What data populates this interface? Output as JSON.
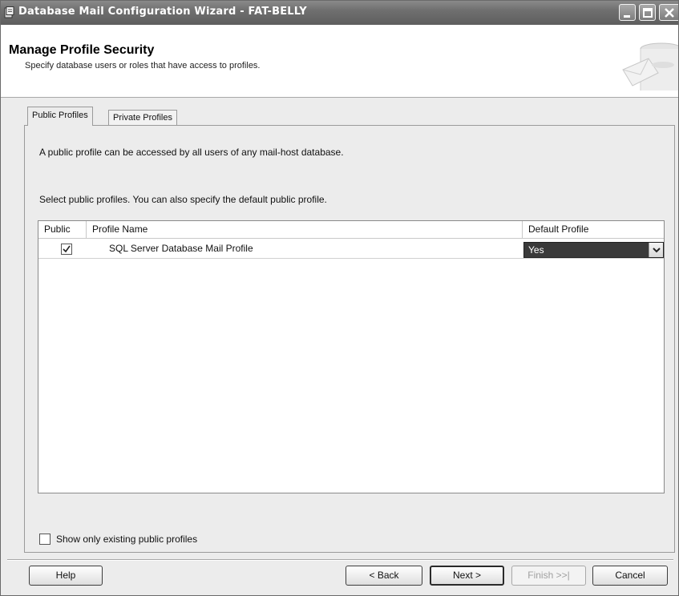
{
  "window": {
    "title": "Database Mail Configuration Wizard - FAT-BELLY",
    "icon": "wizard-app-icon",
    "controls": [
      "minimize-icon",
      "maximize-icon",
      "close-icon"
    ]
  },
  "header": {
    "title": "Manage Profile Security",
    "subtitle": "Specify database users or roles that have access to profiles."
  },
  "tabs": [
    {
      "label": "Public Profiles",
      "selected": true
    },
    {
      "label": "Private Profiles",
      "selected": false
    }
  ],
  "panel": {
    "info_text": "A public profile can be accessed by all users of any mail-host database.",
    "instruction_text": "Select public profiles. You can also specify the default public profile."
  },
  "grid": {
    "columns": [
      "Public",
      "Profile Name",
      "Default Profile"
    ],
    "rows": [
      {
        "public": true,
        "profile_name": "SQL Server Database Mail Profile",
        "default_profile": "Yes"
      }
    ]
  },
  "options": {
    "show_existing_label": "Show only existing public profiles",
    "show_existing_checked": false
  },
  "buttons": {
    "help": "Help",
    "back": "< Back",
    "next": "Next >",
    "finish": "Finish >>|",
    "cancel": "Cancel"
  },
  "colors": {
    "titlebar": "#6f6f6f",
    "selected_cell": "#3a3a3a",
    "dialog_bg": "#ececec"
  }
}
